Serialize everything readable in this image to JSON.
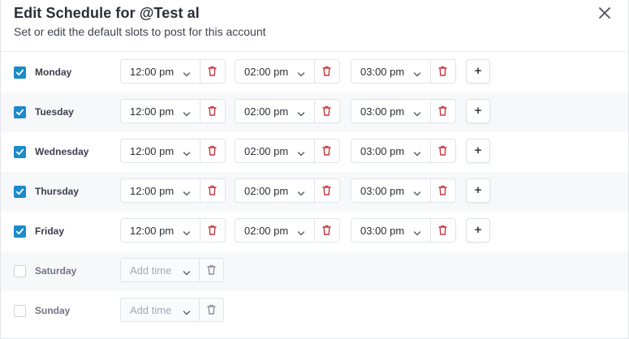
{
  "header": {
    "title": "Edit Schedule for @Test al",
    "subtitle": "Set or edit the default slots to post for this account",
    "close_icon": "close-icon"
  },
  "colors": {
    "accent": "#1b8bc9",
    "delete": "#c8363c"
  },
  "add_label": "+",
  "days": [
    {
      "name": "Monday",
      "checked": true,
      "slots": [
        "12:00 pm",
        "02:00 pm",
        "03:00 pm"
      ]
    },
    {
      "name": "Tuesday",
      "checked": true,
      "slots": [
        "12:00 pm",
        "02:00 pm",
        "03:00 pm"
      ]
    },
    {
      "name": "Wednesday",
      "checked": true,
      "slots": [
        "12:00 pm",
        "02:00 pm",
        "03:00 pm"
      ]
    },
    {
      "name": "Thursday",
      "checked": true,
      "slots": [
        "12:00 pm",
        "02:00 pm",
        "03:00 pm"
      ]
    },
    {
      "name": "Friday",
      "checked": true,
      "slots": [
        "12:00 pm",
        "02:00 pm",
        "03:00 pm"
      ]
    },
    {
      "name": "Saturday",
      "checked": false,
      "slots": [
        "Add time"
      ]
    },
    {
      "name": "Sunday",
      "checked": false,
      "slots": [
        "Add time"
      ]
    }
  ]
}
